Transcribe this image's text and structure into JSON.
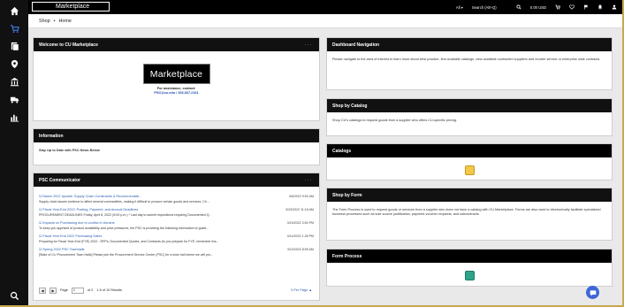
{
  "app": {
    "brand_name": "Marketplace"
  },
  "topbar": {
    "scope": "All ▾",
    "search_placeholder": "Search (Alt+Q)",
    "cart_total": "0.00 USD"
  },
  "breadcrumb": {
    "items": [
      "Shop",
      "•",
      "Home"
    ]
  },
  "left": {
    "welcome": {
      "title": "Welcome to CU Marketplace",
      "more": "···",
      "logo_text": "Marketplace",
      "assist_line1": "For assistance, contact:",
      "assist_link": "PSC@cu.edu / 303.837.2161"
    },
    "information": {
      "title": "Information",
      "body": "Stay Up to Date with PSC News Below"
    },
    "psc": {
      "title": "PSC Communicator",
      "more": "···",
      "news": [
        {
          "title": "☑ March 2022 Update: Supply Chain Constraints & Recommendati...",
          "date": "4/6/2022 9:53 AM",
          "desc": "Supply chain issues continue to affect several commodities, making it difficult to procure certain goods and services. Ch..."
        },
        {
          "title": "☑ Fiscal Year-End 2022: Posting, Payment, and Accrual Deadlines",
          "date": "3/23/2022 11:18 AM",
          "desc": "PROCUREMENT DEADLINES Friday, April 8, 2022 (5:00 p.m.) * Last day to submit requisitions requiring Documented Q..."
        },
        {
          "title": "☑ Impacts on Purchasing due to conflict in Ukraine",
          "date": "3/15/2022 3:50 PM",
          "desc": "To keep you apprised of product availability and price pressures, the PSC is providing the following information to guide..."
        },
        {
          "title": "☑ Fiscal Year End 2022 Purchasing Dates",
          "date": "3/14/2022 1:28 PM",
          "desc": "Preparing for Fiscal Year-End (FYE) 2022 - RFPs, Documented Quotes, and Contracts As you prepare for FYE, remember tha..."
        },
        {
          "title": "☑ Spring 2022 PSC Townhalls",
          "date": "3/10/2022 8:59 AM",
          "desc": "[State of CU Procurement Town Halls] Please join the Procurement Service Center (PSC) for a town hall where we will pro..."
        }
      ],
      "pager": {
        "prev": "◀",
        "next": "▶",
        "page_label": "Page",
        "page_value": "1",
        "of_label": "of 2",
        "results": "1-5 of 10 Results",
        "per_page": "5 Per Page ▲"
      }
    }
  },
  "right": {
    "dashboard_nav": {
      "title": "Dashboard Navigation",
      "body": "Please navigate to the area of interest to learn more about best practice, find available catalogs, view available contracted suppliers and reorder service or enterprise wide contracts."
    },
    "shop_catalog": {
      "title": "Shop by Catalog",
      "body": "Shop CU's catalogs to request goods from a supplier who offers CU-specific pricing."
    },
    "catalogs": {
      "title": "Catalogs",
      "icon_color": "#f2c84b"
    },
    "shop_form": {
      "title": "Shop by Form",
      "body": "The Form Process is used to request goods or services from a supplier who does not have a catalog with CU Marketplace. Forms are also used to electronically facilitate specialized business processes such as sole source justification, payment voucher requests, and subcontracts."
    },
    "form_process": {
      "title": "Form Process",
      "icon_color": "#2fa38a"
    }
  },
  "colors": {
    "accent": "#3f7be4",
    "link": "#2a5db0",
    "header": "#111111",
    "border_gold": "#c8a951"
  }
}
